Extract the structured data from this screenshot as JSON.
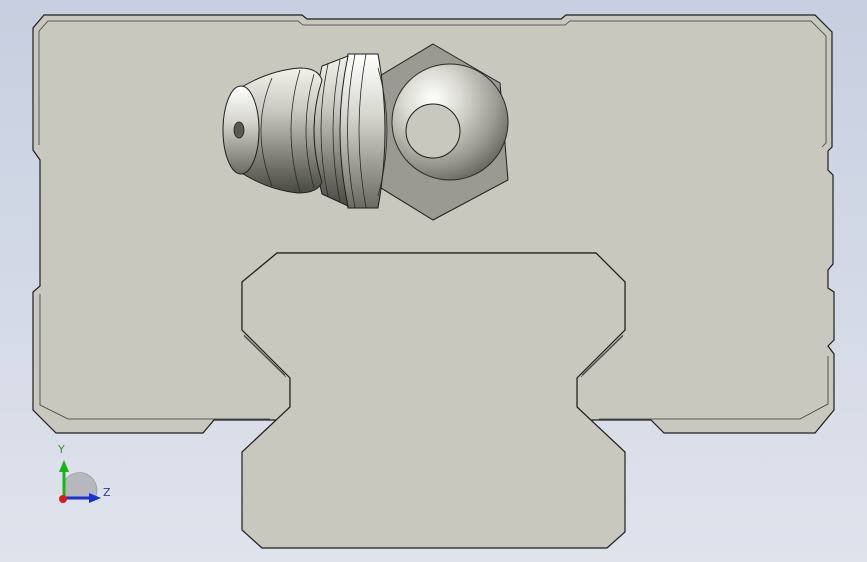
{
  "viewport": {
    "background_top": "#c7cfe0",
    "background_bottom": "#dfe3ec"
  },
  "model": {
    "part_color": "#c8c8be",
    "edge_color": "#1e1e1e",
    "fitting_color": "#9a9a92"
  },
  "triad": {
    "y_label": "Y",
    "z_label": "Z",
    "y_color": "#19b419",
    "z_color": "#1a2fd8",
    "x_color": "#e01818"
  }
}
